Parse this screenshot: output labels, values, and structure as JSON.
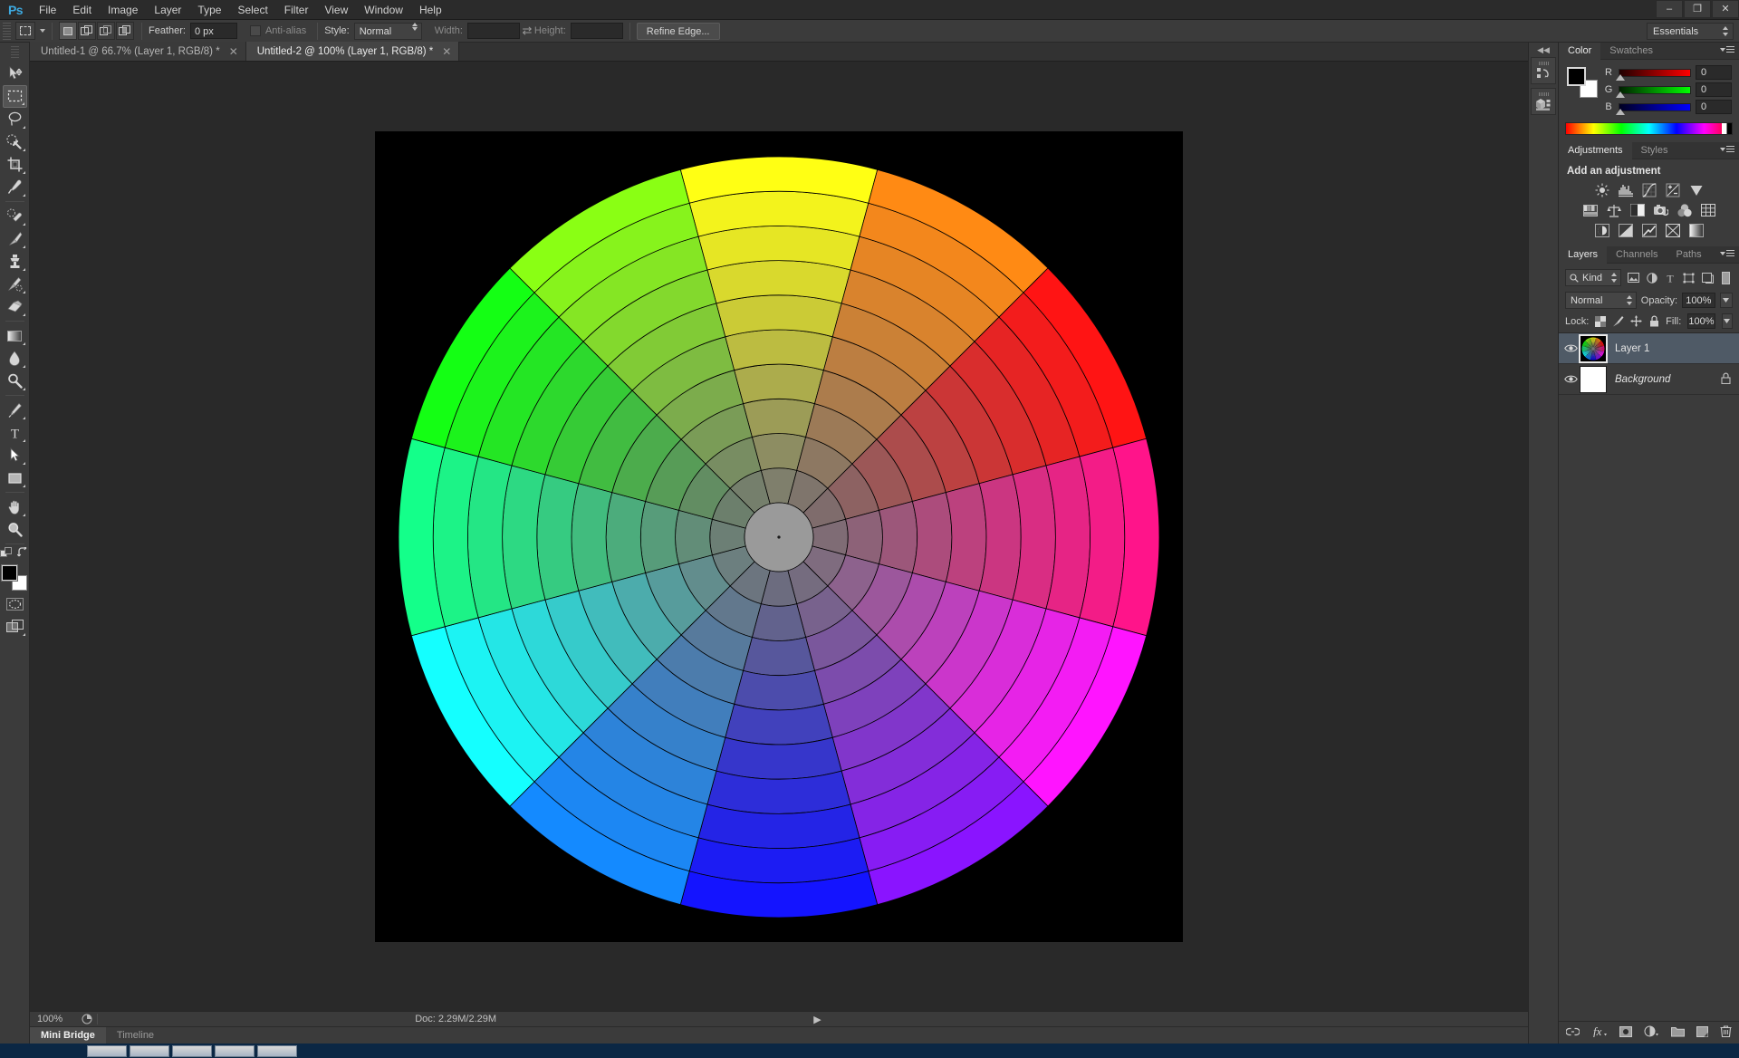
{
  "app": {
    "logo": "Ps",
    "workspace": "Essentials"
  },
  "menubar": {
    "items": [
      "File",
      "Edit",
      "Image",
      "Layer",
      "Type",
      "Select",
      "Filter",
      "View",
      "Window",
      "Help"
    ]
  },
  "window_controls": {
    "minimize": "–",
    "restore": "❐",
    "close": "✕"
  },
  "options_bar": {
    "feather_label": "Feather:",
    "feather_value": "0 px",
    "antialias_label": "Anti-alias",
    "style_label": "Style:",
    "style_value": "Normal",
    "width_label": "Width:",
    "width_value": "",
    "height_label": "Height:",
    "height_value": "",
    "refine_edge_label": "Refine Edge..."
  },
  "tools": [
    {
      "name": "move-tool",
      "label": "Move"
    },
    {
      "name": "rectangular-marquee-tool",
      "label": "Rectangular Marquee",
      "active": true
    },
    {
      "name": "lasso-tool",
      "label": "Lasso"
    },
    {
      "name": "quick-selection-tool",
      "label": "Quick Selection"
    },
    {
      "name": "crop-tool",
      "label": "Crop"
    },
    {
      "name": "eyedropper-tool",
      "label": "Eyedropper"
    },
    {
      "name": "spot-healing-brush-tool",
      "label": "Spot Healing Brush"
    },
    {
      "name": "brush-tool",
      "label": "Brush"
    },
    {
      "name": "clone-stamp-tool",
      "label": "Clone Stamp"
    },
    {
      "name": "history-brush-tool",
      "label": "History Brush"
    },
    {
      "name": "eraser-tool",
      "label": "Eraser"
    },
    {
      "name": "gradient-tool",
      "label": "Gradient"
    },
    {
      "name": "blur-tool",
      "label": "Blur"
    },
    {
      "name": "dodge-tool",
      "label": "Dodge"
    },
    {
      "name": "pen-tool",
      "label": "Pen"
    },
    {
      "name": "type-tool",
      "label": "Horizontal Type"
    },
    {
      "name": "path-selection-tool",
      "label": "Path Selection"
    },
    {
      "name": "rectangle-tool",
      "label": "Rectangle"
    },
    {
      "name": "hand-tool",
      "label": "Hand"
    },
    {
      "name": "zoom-tool",
      "label": "Zoom"
    }
  ],
  "toolbar_colors": {
    "foreground": "#000000",
    "background": "#ffffff"
  },
  "document_tabs": [
    {
      "title": "Untitled-1 @ 66.7% (Layer 1, RGB/8) *",
      "active": false,
      "close": "✕"
    },
    {
      "title": "Untitled-2 @ 100% (Layer 1, RGB/8) *",
      "active": true,
      "close": "✕"
    }
  ],
  "status_bar": {
    "zoom": "100%",
    "doc_info": "Doc: 2.29M/2.29M",
    "arrow": "▶"
  },
  "bottom_tabs": [
    {
      "label": "Mini Bridge",
      "active": true
    },
    {
      "label": "Timeline",
      "active": false
    }
  ],
  "color_panel": {
    "tabs": [
      {
        "label": "Color",
        "active": true
      },
      {
        "label": "Swatches",
        "active": false
      }
    ],
    "channels": [
      {
        "label": "R",
        "value": "0"
      },
      {
        "label": "G",
        "value": "0"
      },
      {
        "label": "B",
        "value": "0"
      }
    ],
    "foreground": "#000000",
    "background": "#ffffff"
  },
  "adjustments_panel": {
    "tabs": [
      {
        "label": "Adjustments",
        "active": true
      },
      {
        "label": "Styles",
        "active": false
      }
    ],
    "heading": "Add an adjustment",
    "icons": [
      [
        "brightness-contrast-icon",
        "levels-icon",
        "curves-icon",
        "exposure-icon",
        "vibrance-icon"
      ],
      [
        "hue-saturation-icon",
        "color-balance-icon",
        "black-white-icon",
        "photo-filter-icon",
        "channel-mixer-icon",
        "color-lookup-icon"
      ],
      [
        "invert-icon",
        "posterize-icon",
        "threshold-icon",
        "selective-color-icon",
        "gradient-map-icon"
      ]
    ]
  },
  "layers_panel": {
    "tabs": [
      {
        "label": "Layers",
        "active": true
      },
      {
        "label": "Channels",
        "active": false
      },
      {
        "label": "Paths",
        "active": false
      }
    ],
    "filter_label": "Kind",
    "filter_icons": [
      "filter-pixel-icon",
      "filter-adjustment-icon",
      "filter-type-icon",
      "filter-shape-icon",
      "filter-smart-object-icon"
    ],
    "blend_mode": "Normal",
    "opacity_label": "Opacity:",
    "opacity_value": "100%",
    "lock_label": "Lock:",
    "lock_icons": [
      "lock-transparent-icon",
      "lock-image-icon",
      "lock-position-icon",
      "lock-all-icon"
    ],
    "fill_label": "Fill:",
    "fill_value": "100%",
    "layers": [
      {
        "name": "Layer 1",
        "selected": true,
        "italic": false,
        "locked": false,
        "visible": true,
        "thumb": "color-wheel"
      },
      {
        "name": "Background",
        "selected": false,
        "italic": true,
        "locked": true,
        "visible": true,
        "thumb": "white"
      }
    ],
    "footer_icons": [
      "link-layers-icon",
      "layer-style-fx-icon",
      "add-layer-mask-icon",
      "new-adjustment-layer-icon",
      "new-group-icon",
      "new-layer-icon",
      "delete-layer-icon"
    ]
  },
  "icon_dock": {
    "collapse": "◀◀",
    "buttons": [
      "history-panel-icon",
      "mini-bridge-panel-icon"
    ]
  },
  "canvas": {
    "background": "#000000",
    "artwork": "color-wheel",
    "wheel": {
      "sectors": 12,
      "rings": 10,
      "hub_color": "#9a9a9a",
      "stroke": "#000000",
      "hues": [
        60,
        30,
        0,
        330,
        300,
        270,
        240,
        210,
        180,
        150,
        120,
        90
      ]
    }
  }
}
